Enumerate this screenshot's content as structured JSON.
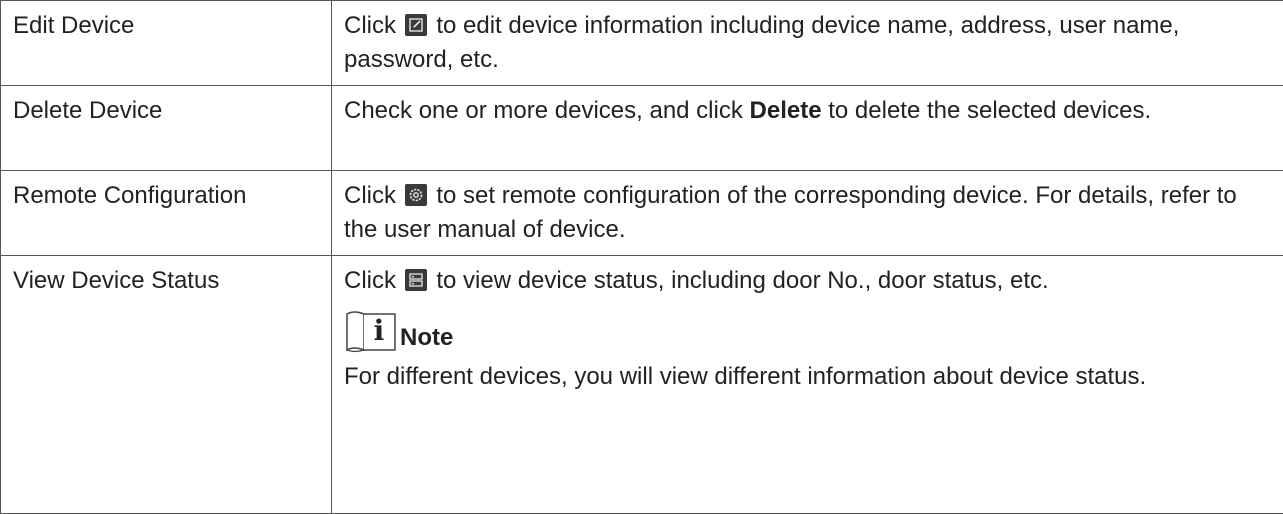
{
  "rows": [
    {
      "label": "Edit Device",
      "desc_before": "Click",
      "icon": "edit-icon",
      "desc_after": "to edit device information including device name, address, user name, password, etc."
    },
    {
      "label": "Delete Device",
      "desc_before": "Check one or more devices, and click",
      "desc_bold": "Delete",
      "desc_after": "to delete the selected devices."
    },
    {
      "label": "Remote Configuration",
      "desc_before": "Click",
      "icon": "gear-icon",
      "desc_after": "to set remote configuration of the corresponding device. For details, refer to the user manual of device."
    },
    {
      "label": "View Device Status",
      "desc_before": "Click",
      "icon": "device-status-icon",
      "desc_after": "to view device status, including door No., door status, etc.",
      "note_label": "Note",
      "note_text": "For different devices, you will view different information about device status."
    }
  ],
  "colors": {
    "border": "#555555",
    "text": "#222222",
    "icon_bg": "#3a3a3a"
  }
}
